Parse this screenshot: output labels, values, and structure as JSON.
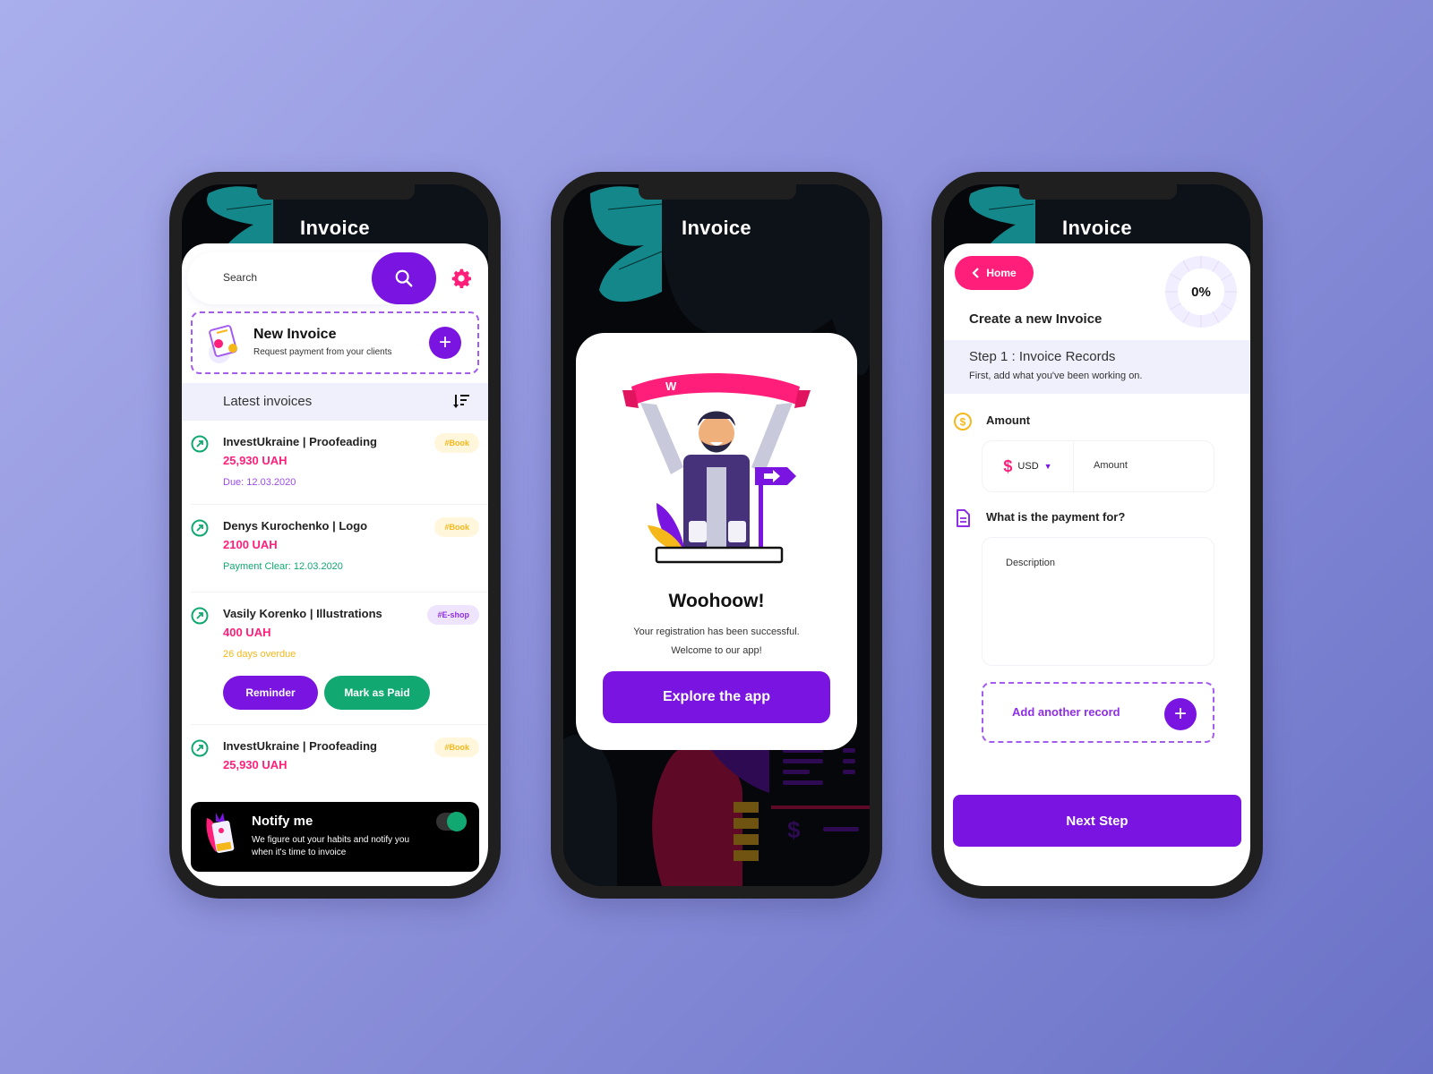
{
  "colors": {
    "primary": "#7a14e0",
    "accent_pink": "#ff1f7a",
    "success_green": "#12a871",
    "warning_yellow": "#f5b81b",
    "dark_bg": "#05070b",
    "teal_leaf": "#13878a"
  },
  "screen1": {
    "title": "Invoice",
    "search": {
      "placeholder": "Search",
      "icon": "search-icon",
      "settings_icon": "gear-icon"
    },
    "new_invoice": {
      "title": "New Invoice",
      "subtitle": "Request payment from your clients",
      "icon": "plus-icon"
    },
    "latest": {
      "label": "Latest invoices",
      "sort_icon": "sort-icon"
    },
    "invoices": [
      {
        "name": "InvestUkraine | Proofeading",
        "amount": "25,930 UAH",
        "meta": "Due: 12.03.2020",
        "meta_color": "#9b4bea",
        "tag": "#Book"
      },
      {
        "name": "Denys Kurochenko | Logo",
        "amount": "2100 UAH",
        "meta": "Payment Clear: 12.03.2020",
        "meta_color": "#12a871",
        "tag": "#Book"
      },
      {
        "name": "Vasily Korenko | Illustrations",
        "amount": "400 UAH",
        "meta": "26 days overdue",
        "meta_color": "#f5b81b",
        "tag": "#E-shop",
        "actions": {
          "reminder": "Reminder",
          "mark_paid": "Mark as Paid"
        }
      },
      {
        "name": "InvestUkraine | Proofeading",
        "amount": "25,930 UAH",
        "tag": "#Book"
      }
    ],
    "notify": {
      "title": "Notify me",
      "subtitle": "We figure out your habits and notify you when it's time to invoice",
      "toggle_on": true
    }
  },
  "screen2": {
    "title": "Invoice",
    "banner_letter": "W",
    "modal_title": "Woohoow!",
    "modal_line1": "Your registration has been successful.",
    "modal_line2": "Welcome to our app!",
    "cta": "Explore the app"
  },
  "screen3": {
    "title": "Invoice",
    "home_button": "Home",
    "progress": "0%",
    "progress_value": 0,
    "heading": "Create a new Invoice",
    "step_title": "Step 1 : Invoice Records",
    "step_sub": "First, add what you've been working on.",
    "amount_label": "Amount",
    "currency_symbol": "$",
    "currency_code": "USD",
    "amount_placeholder": "Amount",
    "payment_for_label": "What is the payment for?",
    "description_placeholder": "Description",
    "add_record": "Add another record",
    "next_step": "Next Step"
  }
}
